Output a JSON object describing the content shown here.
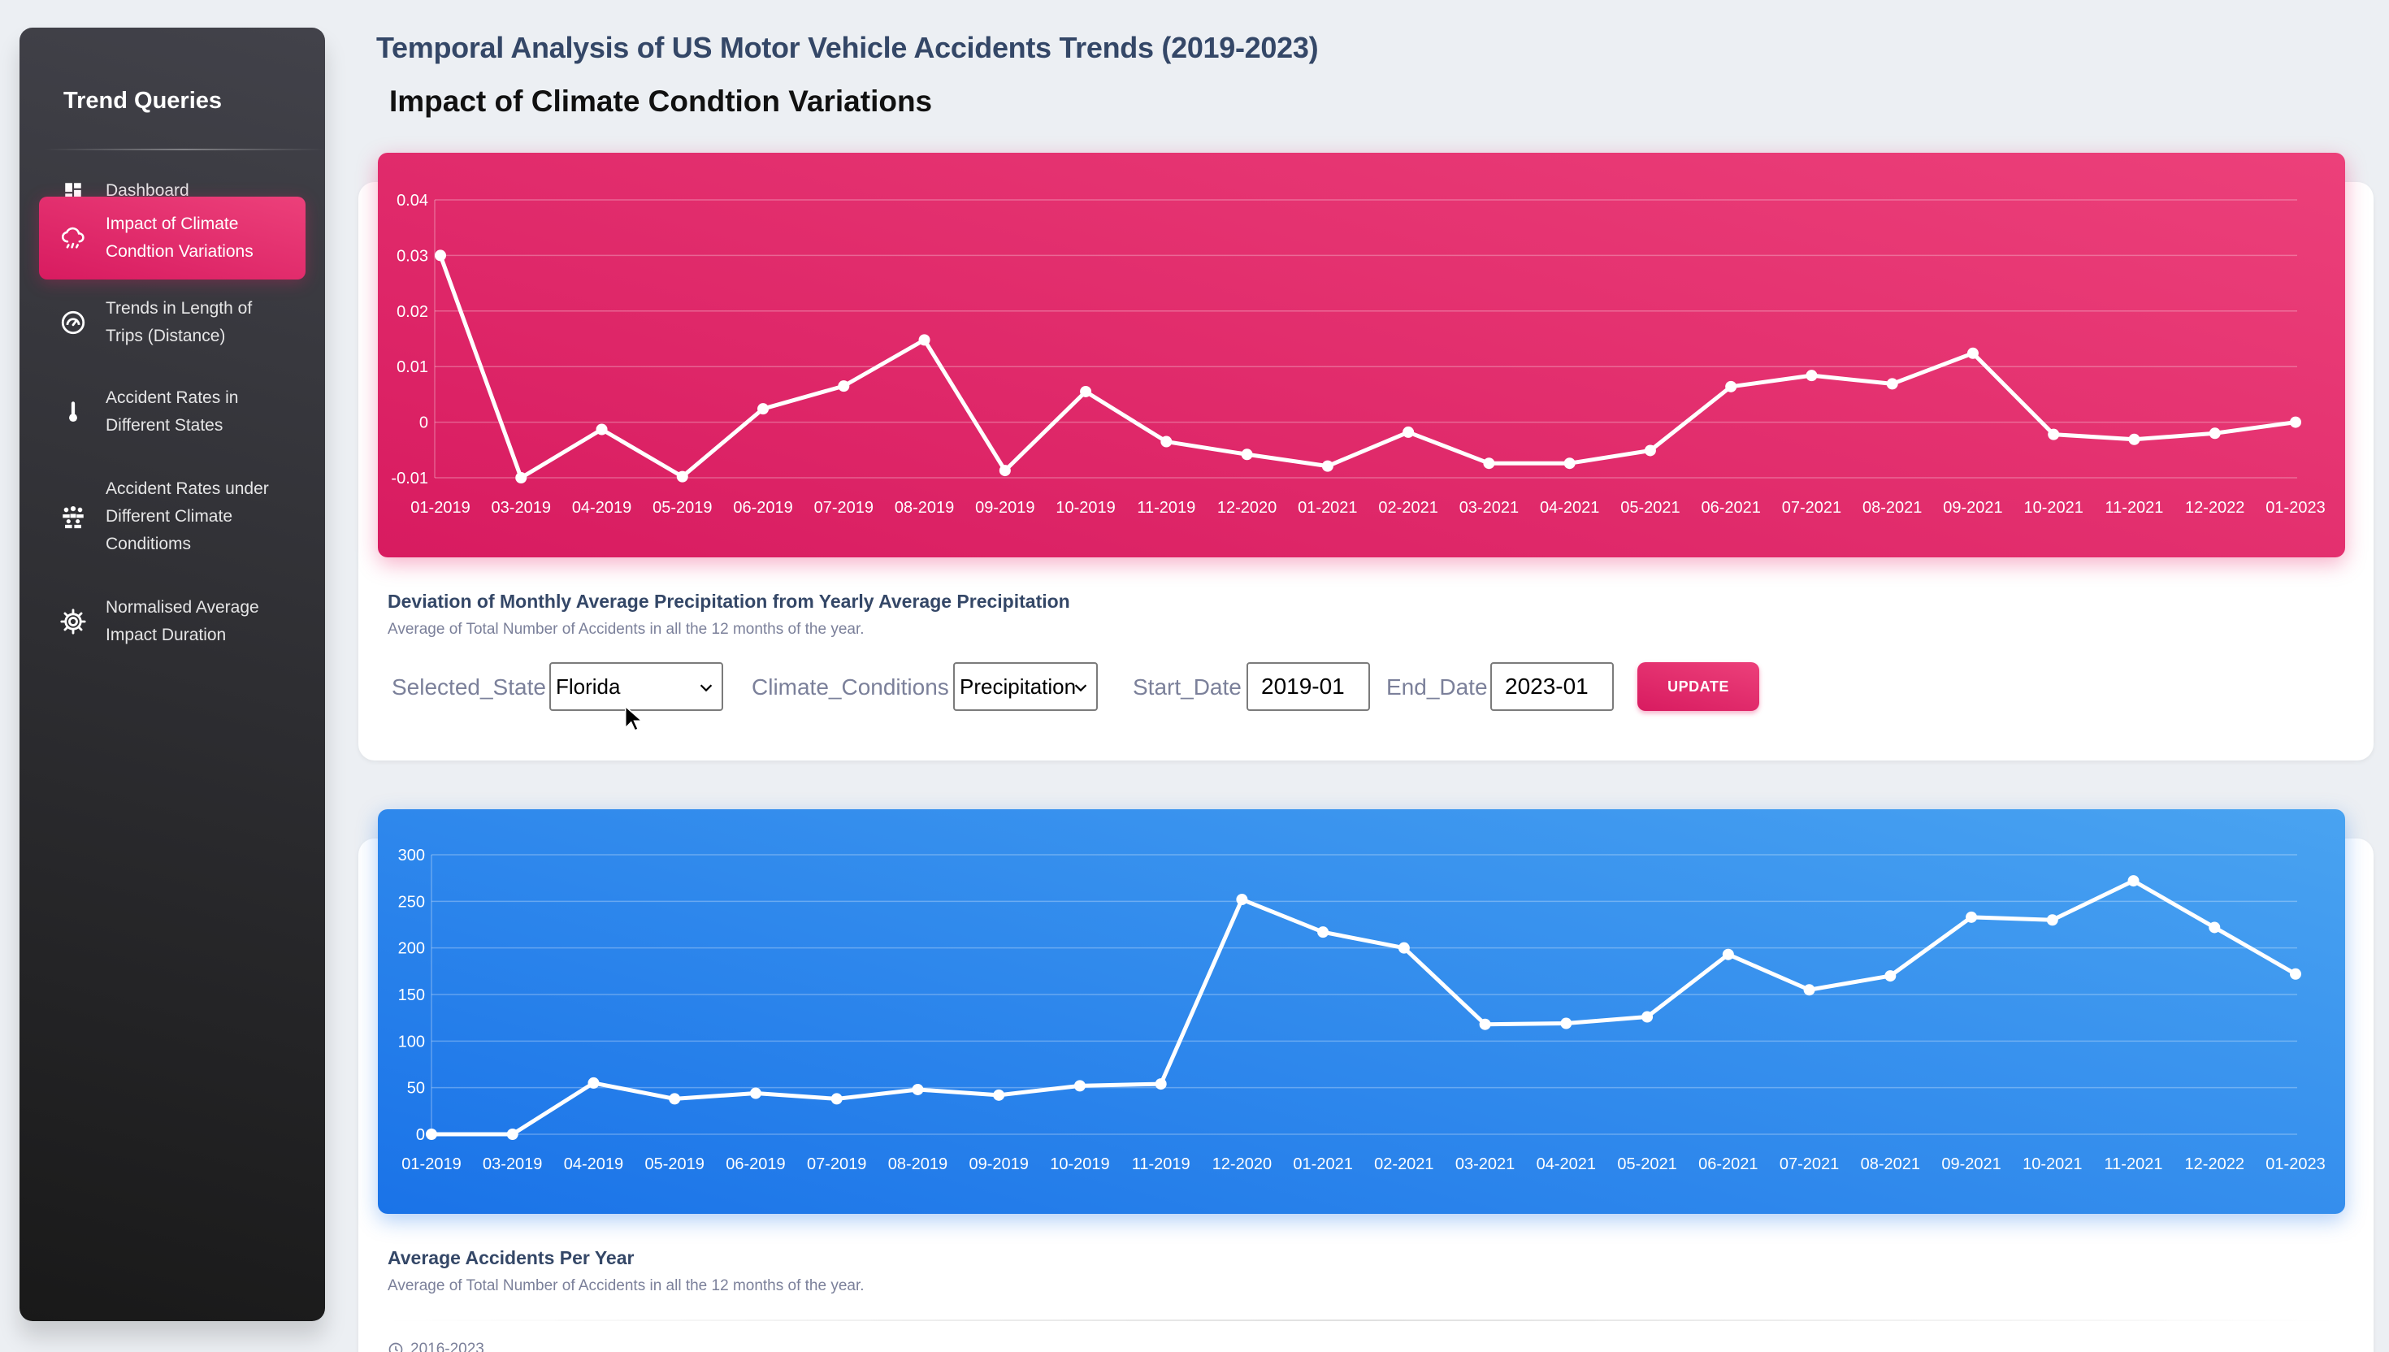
{
  "sidebar": {
    "brand": "Trend Queries",
    "items": [
      {
        "label": "Dashboard",
        "icon": "dashboard-icon",
        "active": false
      },
      {
        "label": "Impact of Climate Condtion Variations",
        "icon": "rain-cloud-icon",
        "active": true
      },
      {
        "label": "Trends in Length of Trips (Distance)",
        "icon": "speedometer-icon",
        "active": false
      },
      {
        "label": "Accident Rates in Different States",
        "icon": "thermometer-icon",
        "active": false
      },
      {
        "label": "Accident Rates under Different Climate Conditioms",
        "icon": "people-group-icon",
        "active": false
      },
      {
        "label": "Normalised Average Impact Duration",
        "icon": "gear-icon",
        "active": false
      }
    ]
  },
  "header": {
    "title": "Temporal Analysis of US Motor Vehicle Accidents Trends (2019-2023)",
    "section": "Impact of Climate Condtion Variations"
  },
  "card1": {
    "heading": "Deviation of Monthly Average Precipitation from Yearly Average Precipitation",
    "subtitle": "Average of Total Number of Accidents in all the 12 months of the year.",
    "controls": {
      "state_label": "Selected_State",
      "state_value": "Florida",
      "climate_label": "Climate_Conditions",
      "climate_value": "Precipitation",
      "start_label": "Start_Date",
      "start_value": "2019-01",
      "end_label": "End_Date",
      "end_value": "2023-01",
      "update_label": "UPDATE"
    }
  },
  "card2": {
    "heading": "Average Accidents Per Year",
    "subtitle": "Average of Total Number of Accidents in all the 12 months of the year.",
    "footer_note": "2016-2023"
  },
  "colors": {
    "pink_accent": "#e91e63",
    "blue_accent": "#1a73e8",
    "sidebar_dark": "#191919"
  },
  "chart_data": [
    {
      "type": "line",
      "title": "",
      "categories": [
        "01-2019",
        "03-2019",
        "04-2019",
        "05-2019",
        "06-2019",
        "07-2019",
        "08-2019",
        "09-2019",
        "10-2019",
        "11-2019",
        "12-2020",
        "01-2021",
        "02-2021",
        "03-2021",
        "04-2021",
        "05-2021",
        "06-2021",
        "07-2021",
        "08-2021",
        "09-2021",
        "10-2021",
        "11-2021",
        "12-2022",
        "01-2023"
      ],
      "values": [
        0.03,
        -0.01,
        -0.0013,
        -0.0098,
        0.0024,
        0.0065,
        0.0148,
        -0.0087,
        0.0055,
        -0.0035,
        -0.0058,
        -0.0079,
        -0.0018,
        -0.0074,
        -0.0074,
        -0.0051,
        0.0064,
        0.0084,
        0.0069,
        0.0124,
        -0.0022,
        -0.0031,
        -0.002,
        0.0
      ],
      "ylim": [
        -0.01,
        0.04
      ],
      "yticks": [
        0.04,
        0.03,
        0.02,
        0.01,
        0,
        -0.01
      ],
      "grid": true
    },
    {
      "type": "line",
      "title": "",
      "categories": [
        "01-2019",
        "03-2019",
        "04-2019",
        "05-2019",
        "06-2019",
        "07-2019",
        "08-2019",
        "09-2019",
        "10-2019",
        "11-2019",
        "12-2020",
        "01-2021",
        "02-2021",
        "03-2021",
        "04-2021",
        "05-2021",
        "06-2021",
        "07-2021",
        "08-2021",
        "09-2021",
        "10-2021",
        "11-2021",
        "12-2022",
        "01-2023"
      ],
      "values": [
        0,
        0,
        55,
        38,
        44,
        38,
        48,
        42,
        52,
        54,
        252,
        217,
        200,
        118,
        119,
        126,
        193,
        155,
        170,
        233,
        230,
        272,
        222,
        172
      ],
      "ylim": [
        0,
        300
      ],
      "yticks": [
        300,
        250,
        200,
        150,
        100,
        50,
        0
      ],
      "grid": true
    }
  ]
}
